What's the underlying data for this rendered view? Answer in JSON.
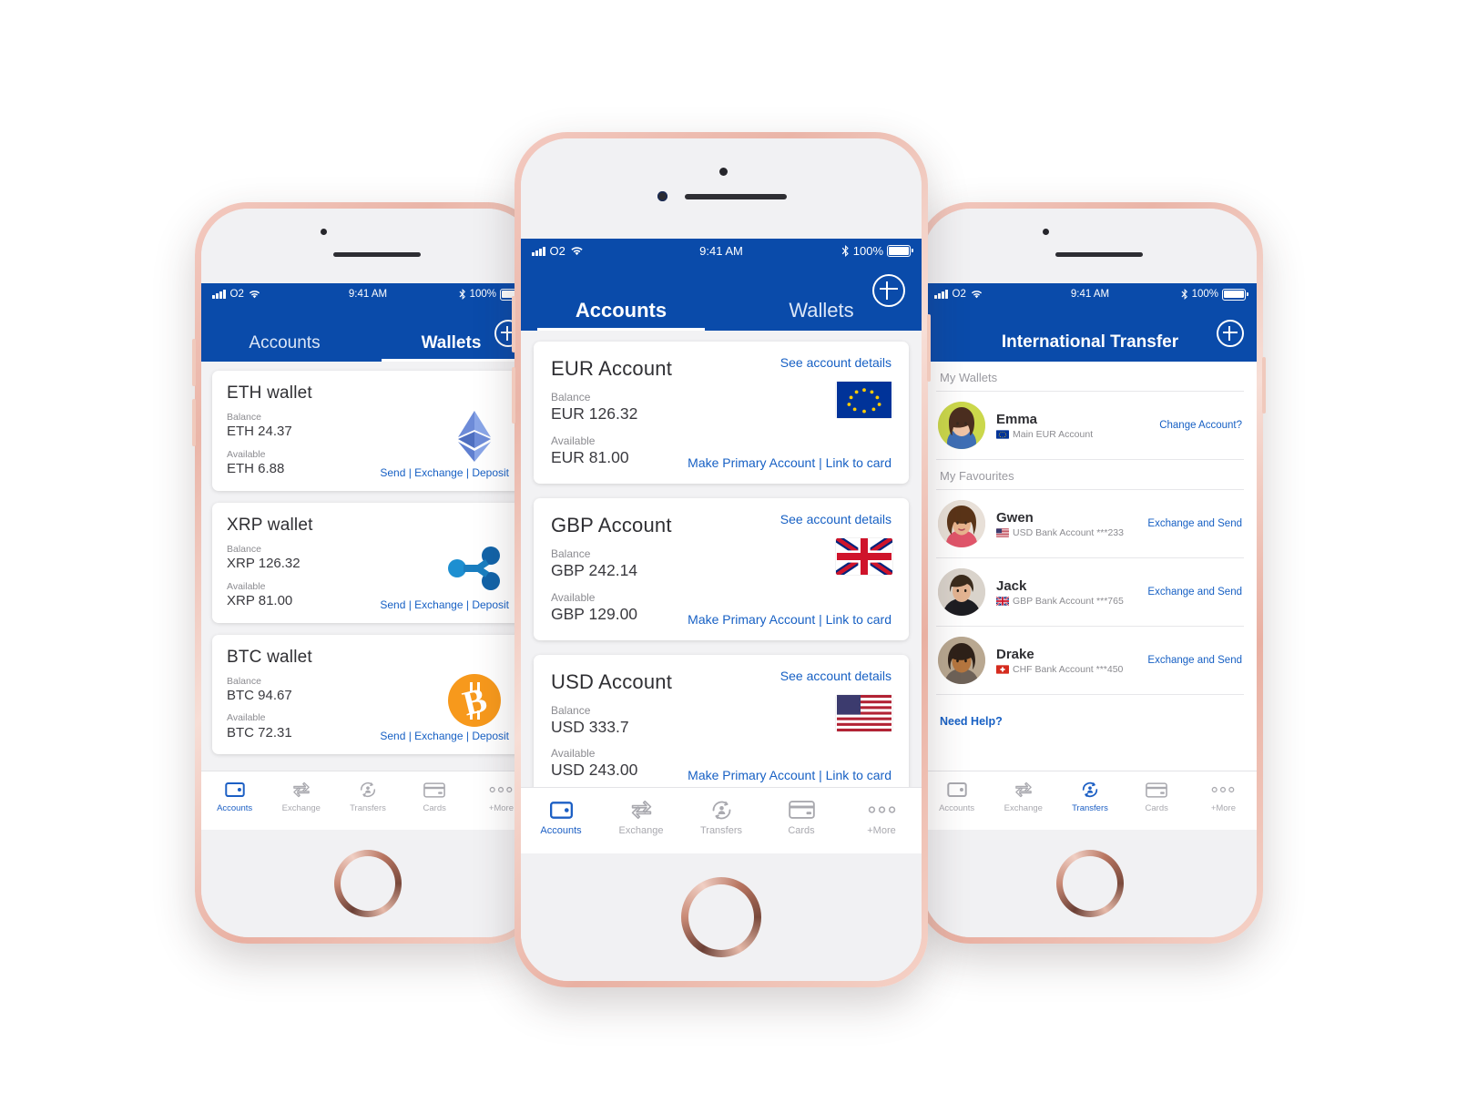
{
  "colors": {
    "brand_blue": "#0a4baa",
    "link_blue": "#1760c4",
    "active_tab_blue": "#1c5fc4",
    "bitcoin_orange": "#f7931a",
    "ripple_blue": "#1b7fc4",
    "eth_blue": "#627eea"
  },
  "status_bar": {
    "carrier": "O2",
    "time": "9:41 AM",
    "battery_percent": "100%",
    "signal_icon": "signal-bars-icon",
    "wifi_icon": "wifi-icon",
    "bluetooth_icon": "bluetooth-icon",
    "battery_icon": "battery-icon"
  },
  "phone_left": {
    "screen_name": "Wallets",
    "header": {
      "tabs": [
        {
          "label": "Accounts",
          "active": false
        },
        {
          "label": "Wallets",
          "active": true
        }
      ],
      "add_button_icon": "plus-circle-icon"
    },
    "wallets": [
      {
        "title": "ETH wallet",
        "balance_label": "Balance",
        "balance_value": "ETH 24.37",
        "available_label": "Available",
        "available_value": "ETH 6.88",
        "actions": "Send | Exchange | Deposit",
        "icon": "ethereum-icon"
      },
      {
        "title": "XRP wallet",
        "balance_label": "Balance",
        "balance_value": "XRP 126.32",
        "available_label": "Available",
        "available_value": "XRP 81.00",
        "actions": "Send | Exchange | Deposit",
        "icon": "ripple-icon"
      },
      {
        "title": "BTC wallet",
        "balance_label": "Balance",
        "balance_value": "BTC 94.67",
        "available_label": "Available",
        "available_value": "BTC 72.31",
        "actions": "Send | Exchange | Deposit",
        "icon": "bitcoin-icon"
      }
    ],
    "tabbar": [
      {
        "label": "Accounts",
        "icon": "wallet-icon",
        "active": true
      },
      {
        "label": "Exchange",
        "icon": "exchange-arrows-icon",
        "active": false
      },
      {
        "label": "Transfers",
        "icon": "transfers-person-icon",
        "active": false
      },
      {
        "label": "Cards",
        "icon": "credit-card-icon",
        "active": false
      },
      {
        "label": "+More",
        "icon": "more-dots-icon",
        "active": false
      }
    ]
  },
  "phone_center": {
    "screen_name": "Accounts",
    "header": {
      "tabs": [
        {
          "label": "Accounts",
          "active": true
        },
        {
          "label": "Wallets",
          "active": false
        }
      ],
      "add_button_icon": "plus-circle-icon"
    },
    "accounts": [
      {
        "title": "EUR Account",
        "details_link": "See account details",
        "balance_label": "Balance",
        "balance_value": "EUR 126.32",
        "available_label": "Available",
        "available_value": "EUR 81.00",
        "actions": "Make Primary Account | Link to card",
        "flag": "eu-flag-icon"
      },
      {
        "title": "GBP Account",
        "details_link": "See account details",
        "balance_label": "Balance",
        "balance_value": "GBP 242.14",
        "available_label": "Available",
        "available_value": "GBP 129.00",
        "actions": "Make Primary Account | Link to card",
        "flag": "uk-flag-icon"
      },
      {
        "title": "USD Account",
        "details_link": "See account details",
        "balance_label": "Balance",
        "balance_value": "USD 333.7",
        "available_label": "Available",
        "available_value": "USD 243.00",
        "actions": "Make Primary Account | Link to card",
        "flag": "us-flag-icon"
      }
    ],
    "tabbar": [
      {
        "label": "Accounts",
        "icon": "wallet-icon",
        "active": true
      },
      {
        "label": "Exchange",
        "icon": "exchange-arrows-icon",
        "active": false
      },
      {
        "label": "Transfers",
        "icon": "transfers-person-icon",
        "active": false
      },
      {
        "label": "Cards",
        "icon": "credit-card-icon",
        "active": false
      },
      {
        "label": "+More",
        "icon": "more-dots-icon",
        "active": false
      }
    ]
  },
  "phone_right": {
    "screen_name": "International Transfer",
    "header": {
      "title": "International Transfer",
      "add_button_icon": "plus-circle-icon"
    },
    "sections": [
      {
        "heading": "My Wallets"
      },
      {
        "heading": "My Favourites"
      }
    ],
    "my_wallets": [
      {
        "name": "Emma",
        "account": "Main EUR Account",
        "flag": "eu-flag-icon",
        "action": "Change Account?"
      }
    ],
    "favourites": [
      {
        "name": "Gwen",
        "account": "USD Bank Account ***233",
        "flag": "us-flag-icon",
        "action": "Exchange and Send"
      },
      {
        "name": "Jack",
        "account": "GBP Bank Account ***765",
        "flag": "uk-flag-icon",
        "action": "Exchange and Send"
      },
      {
        "name": "Drake",
        "account": "CHF Bank Account ***450",
        "flag": "ch-flag-icon",
        "action": "Exchange and Send"
      }
    ],
    "need_help": "Need Help?",
    "tabbar": [
      {
        "label": "Accounts",
        "icon": "wallet-icon",
        "active": false
      },
      {
        "label": "Exchange",
        "icon": "exchange-arrows-icon",
        "active": false
      },
      {
        "label": "Transfers",
        "icon": "transfers-person-icon",
        "active": true
      },
      {
        "label": "Cards",
        "icon": "credit-card-icon",
        "active": false
      },
      {
        "label": "+More",
        "icon": "more-dots-icon",
        "active": false
      }
    ]
  }
}
